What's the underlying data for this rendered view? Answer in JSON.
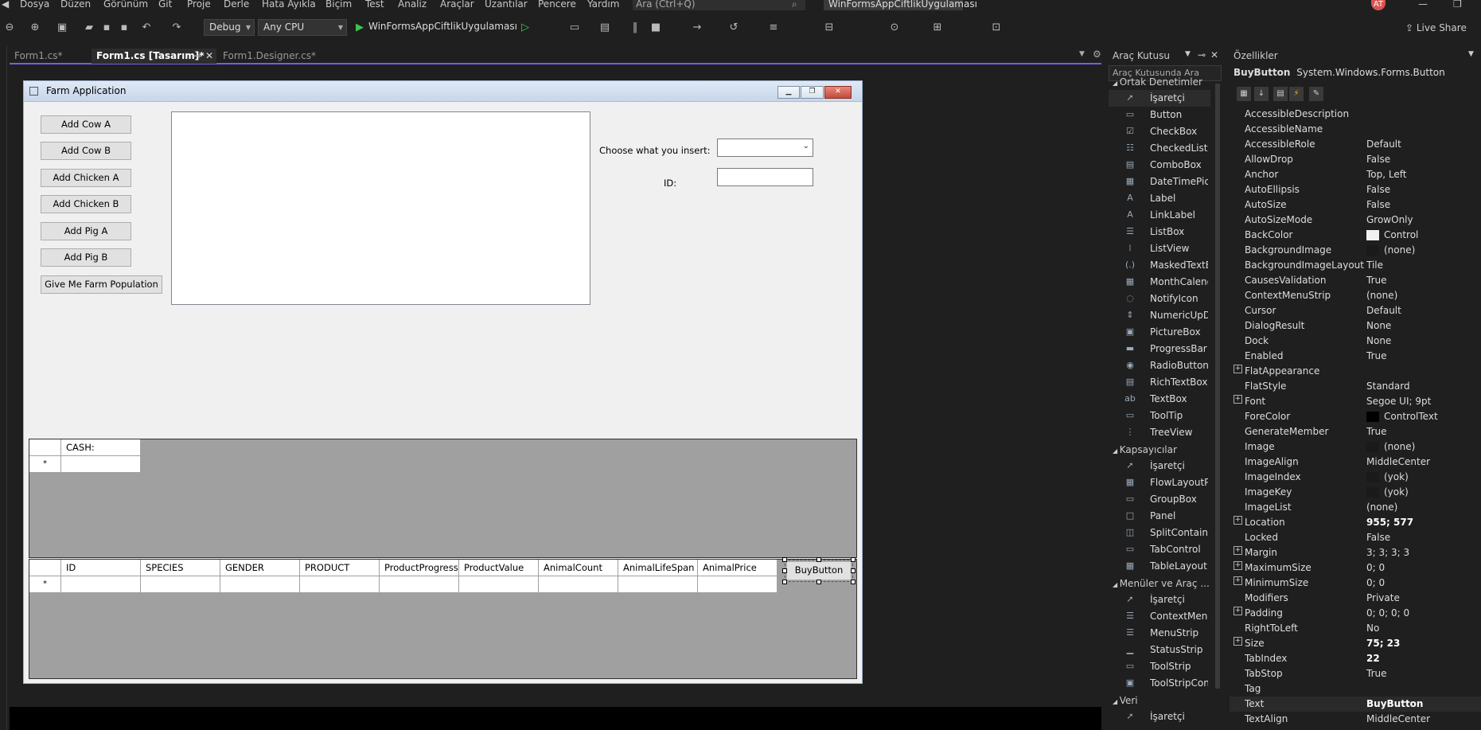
{
  "menu": {
    "items": [
      "Dosya",
      "Düzen",
      "Görünüm",
      "Git",
      "Proje",
      "Derle",
      "Hata Ayıkla",
      "Biçim",
      "Test",
      "Analiz",
      "Araçlar",
      "Uzantılar",
      "Pencere",
      "Yardım"
    ],
    "search_placeholder": "Ara (Ctrl+Q)",
    "solution_name": "WinFormsAppCiftlikUygulaması",
    "user_initials": "AT"
  },
  "toolbar": {
    "config": "Debug",
    "platform": "Any CPU",
    "run_target": "WinFormsAppCiftlikUygulaması",
    "live_share": "Live Share"
  },
  "tabs": [
    {
      "label": "Form1.cs*",
      "active": false
    },
    {
      "label": "Form1.cs [Tasarım]*",
      "active": true
    },
    {
      "label": "Form1.Designer.cs*",
      "active": false
    }
  ],
  "form": {
    "title": "Farm Application",
    "buttons": [
      "Add Cow A",
      "Add Cow B",
      "Add Chicken A",
      "Add Chicken B",
      "Add Pig A",
      "Add Pig B",
      "Give Me Farm Population"
    ],
    "choose_label": "Choose what you insert:",
    "id_label": "ID:",
    "cash_grid": {
      "columns": [
        "CASH:"
      ],
      "new_row_marker": "*"
    },
    "animal_grid": {
      "columns": [
        "ID",
        "SPECIES",
        "GENDER",
        "PRODUCT",
        "ProductProgress",
        "ProductValue",
        "AnimalCount",
        "AnimalLifeSpan",
        "AnimalPrice"
      ],
      "new_row_marker": "*"
    },
    "buy_button": "BuyButton"
  },
  "toolbox": {
    "title": "Araç Kutusu",
    "search_placeholder": "Araç Kutusunda Ara",
    "sections": [
      {
        "name": "Ortak Denetimler",
        "items": [
          {
            "label": "İşaretçi",
            "icon": "pointer-icon",
            "glyph": "➚"
          },
          {
            "label": "Button",
            "icon": "button-icon",
            "glyph": "▭"
          },
          {
            "label": "CheckBox",
            "icon": "checkbox-icon",
            "glyph": "☑"
          },
          {
            "label": "CheckedListBox",
            "icon": "checkedlist-icon",
            "glyph": "☷"
          },
          {
            "label": "ComboBox",
            "icon": "combobox-icon",
            "glyph": "▤"
          },
          {
            "label": "DateTimePicker",
            "icon": "datetime-icon",
            "glyph": "▦"
          },
          {
            "label": "Label",
            "icon": "label-icon",
            "glyph": "A"
          },
          {
            "label": "LinkLabel",
            "icon": "linklabel-icon",
            "glyph": "A"
          },
          {
            "label": "ListBox",
            "icon": "listbox-icon",
            "glyph": "☰"
          },
          {
            "label": "ListView",
            "icon": "listview-icon",
            "glyph": "⁞"
          },
          {
            "label": "MaskedTextBox",
            "icon": "maskedtext-icon",
            "glyph": "(.)"
          },
          {
            "label": "MonthCalendar",
            "icon": "calendar-icon",
            "glyph": "▦"
          },
          {
            "label": "NotifyIcon",
            "icon": "notify-icon",
            "glyph": "◌"
          },
          {
            "label": "NumericUpDown",
            "icon": "numeric-icon",
            "glyph": "⇕"
          },
          {
            "label": "PictureBox",
            "icon": "picture-icon",
            "glyph": "▣"
          },
          {
            "label": "ProgressBar",
            "icon": "progressbar-icon",
            "glyph": "▬"
          },
          {
            "label": "RadioButton",
            "icon": "radio-icon",
            "glyph": "◉"
          },
          {
            "label": "RichTextBox",
            "icon": "richtext-icon",
            "glyph": "▤"
          },
          {
            "label": "TextBox",
            "icon": "textbox-icon",
            "glyph": "ab"
          },
          {
            "label": "ToolTip",
            "icon": "tooltip-icon",
            "glyph": "▭"
          },
          {
            "label": "TreeView",
            "icon": "treeview-icon",
            "glyph": "⋮"
          }
        ]
      },
      {
        "name": "Kapsayıcılar",
        "items": [
          {
            "label": "İşaretçi",
            "icon": "pointer-icon",
            "glyph": "➚"
          },
          {
            "label": "FlowLayoutPanel",
            "icon": "flowlayout-icon",
            "glyph": "▦"
          },
          {
            "label": "GroupBox",
            "icon": "groupbox-icon",
            "glyph": "▭"
          },
          {
            "label": "Panel",
            "icon": "panel-icon",
            "glyph": "□"
          },
          {
            "label": "SplitContainer",
            "icon": "split-icon",
            "glyph": "◫"
          },
          {
            "label": "TabControl",
            "icon": "tabcontrol-icon",
            "glyph": "▭"
          },
          {
            "label": "TableLayoutPanel",
            "icon": "tablelayout-icon",
            "glyph": "▦"
          }
        ]
      },
      {
        "name": "Menüler ve Araç ...",
        "items": [
          {
            "label": "İşaretçi",
            "icon": "pointer-icon",
            "glyph": "➚"
          },
          {
            "label": "ContextMenuStrip",
            "icon": "contextmenu-icon",
            "glyph": "☰"
          },
          {
            "label": "MenuStrip",
            "icon": "menustrip-icon",
            "glyph": "☰"
          },
          {
            "label": "StatusStrip",
            "icon": "statusstrip-icon",
            "glyph": "▁"
          },
          {
            "label": "ToolStrip",
            "icon": "toolstrip-icon",
            "glyph": "▭"
          },
          {
            "label": "ToolStripContainer",
            "icon": "toolstripcontainer-icon",
            "glyph": "▣"
          }
        ]
      },
      {
        "name": "Veri",
        "items": [
          {
            "label": "İşaretçi",
            "icon": "pointer-icon",
            "glyph": "➚"
          }
        ]
      }
    ]
  },
  "properties": {
    "title": "Özellikler",
    "object_name": "BuyButton",
    "object_type": "System.Windows.Forms.Button",
    "rows": [
      {
        "name": "AccessibleDescription",
        "value": ""
      },
      {
        "name": "AccessibleName",
        "value": ""
      },
      {
        "name": "AccessibleRole",
        "value": "Default"
      },
      {
        "name": "AllowDrop",
        "value": "False"
      },
      {
        "name": "Anchor",
        "value": "Top, Left"
      },
      {
        "name": "AutoEllipsis",
        "value": "False"
      },
      {
        "name": "AutoSize",
        "value": "False"
      },
      {
        "name": "AutoSizeMode",
        "value": "GrowOnly"
      },
      {
        "name": "BackColor",
        "value": "Control",
        "swatch": "#f0f0f0"
      },
      {
        "name": "BackgroundImage",
        "value": "(none)",
        "swatch": "#1a1a1a"
      },
      {
        "name": "BackgroundImageLayout",
        "value": "Tile"
      },
      {
        "name": "CausesValidation",
        "value": "True"
      },
      {
        "name": "ContextMenuStrip",
        "value": "(none)"
      },
      {
        "name": "Cursor",
        "value": "Default"
      },
      {
        "name": "DialogResult",
        "value": "None"
      },
      {
        "name": "Dock",
        "value": "None"
      },
      {
        "name": "Enabled",
        "value": "True"
      },
      {
        "name": "FlatAppearance",
        "value": "",
        "expand": true
      },
      {
        "name": "FlatStyle",
        "value": "Standard"
      },
      {
        "name": "Font",
        "value": "Segoe UI; 9pt",
        "expand": true
      },
      {
        "name": "ForeColor",
        "value": "ControlText",
        "swatch": "#000000"
      },
      {
        "name": "GenerateMember",
        "value": "True"
      },
      {
        "name": "Image",
        "value": "(none)",
        "swatch": "#1a1a1a"
      },
      {
        "name": "ImageAlign",
        "value": "MiddleCenter"
      },
      {
        "name": "ImageIndex",
        "value": "(yok)",
        "swatch": "#1a1a1a"
      },
      {
        "name": "ImageKey",
        "value": "(yok)",
        "swatch": "#1a1a1a"
      },
      {
        "name": "ImageList",
        "value": "(none)"
      },
      {
        "name": "Location",
        "value": "955; 577",
        "expand": true,
        "bold": true
      },
      {
        "name": "Locked",
        "value": "False"
      },
      {
        "name": "Margin",
        "value": "3; 3; 3; 3",
        "expand": true
      },
      {
        "name": "MaximumSize",
        "value": "0; 0",
        "expand": true
      },
      {
        "name": "MinimumSize",
        "value": "0; 0",
        "expand": true
      },
      {
        "name": "Modifiers",
        "value": "Private"
      },
      {
        "name": "Padding",
        "value": "0; 0; 0; 0",
        "expand": true
      },
      {
        "name": "RightToLeft",
        "value": "No"
      },
      {
        "name": "Size",
        "value": "75; 23",
        "expand": true,
        "bold": true
      },
      {
        "name": "TabIndex",
        "value": "22",
        "bold": true
      },
      {
        "name": "TabStop",
        "value": "True"
      },
      {
        "name": "Tag",
        "value": ""
      },
      {
        "name": "Text",
        "value": "BuyButton",
        "bold": true,
        "highlight": true
      },
      {
        "name": "TextAlign",
        "value": "MiddleCenter"
      }
    ]
  }
}
